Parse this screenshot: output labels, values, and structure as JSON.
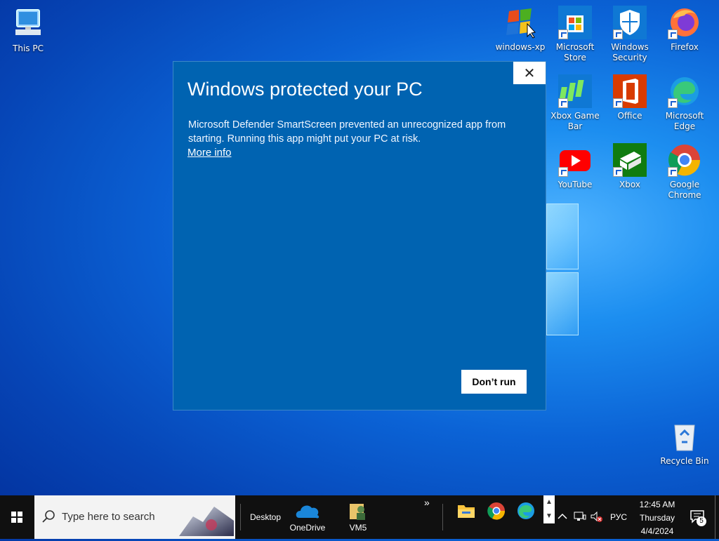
{
  "desktop": {
    "icons": [
      {
        "label": "This PC"
      },
      {
        "label": "windows-xp"
      },
      {
        "label": "Microsoft Store"
      },
      {
        "label": "Windows Security"
      },
      {
        "label": "Firefox"
      },
      {
        "label": "Xbox Game Bar"
      },
      {
        "label": "Office"
      },
      {
        "label": "Microsoft Edge"
      },
      {
        "label": "YouTube"
      },
      {
        "label": "Xbox"
      },
      {
        "label": "Google Chrome"
      },
      {
        "label": "Recycle Bin"
      }
    ]
  },
  "dialog": {
    "title": "Windows protected your PC",
    "message": "Microsoft Defender SmartScreen prevented an unrecognized app from starting. Running this app might put your PC at risk.",
    "more_info": "More info",
    "dont_run": "Don’t run",
    "close_symbol": "✕"
  },
  "taskbar": {
    "search_placeholder": "Type here to search",
    "desktop_label": "Desktop",
    "onedrive_label": "OneDrive",
    "vm5_label": "VM5",
    "overflow": "»",
    "language": "РУС",
    "time": "12:45 AM",
    "day": "Thursday",
    "date": "4/4/2024",
    "notification_count": "5"
  },
  "colors": {
    "dialog_bg": "#0063b1",
    "taskbar_bg": "#101010"
  }
}
